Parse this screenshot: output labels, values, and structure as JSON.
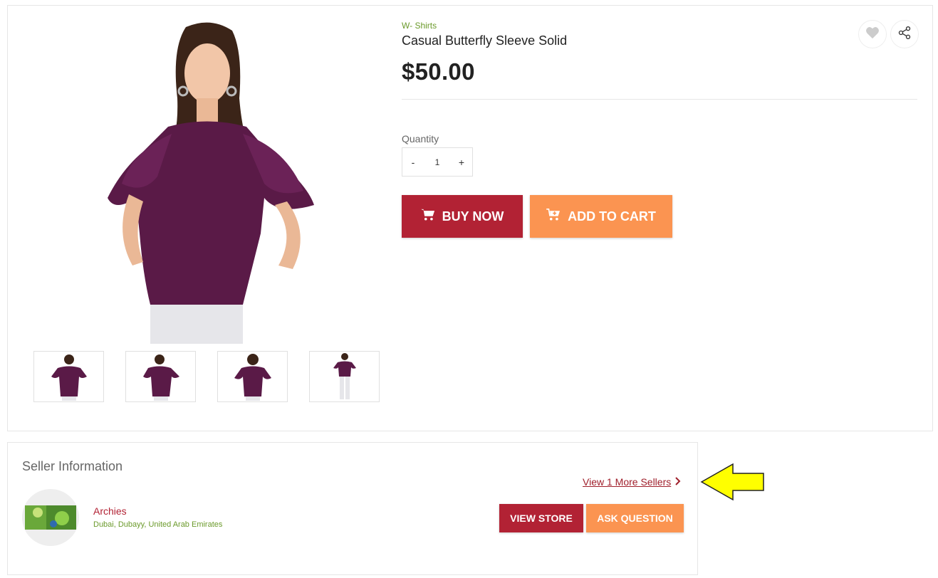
{
  "product": {
    "category": "W- Shirts",
    "title": "Casual Butterfly Sleeve Solid",
    "price": "$50.00",
    "quantity_label": "Quantity",
    "quantity_value": "1",
    "decrement": "-",
    "increment": "+",
    "buy_now": "BUY NOW",
    "add_to_cart": "ADD TO CART",
    "image_color": "#5a1a47",
    "thumbnails": [
      {
        "name": "thumb-front"
      },
      {
        "name": "thumb-side"
      },
      {
        "name": "thumb-back"
      },
      {
        "name": "thumb-full"
      }
    ]
  },
  "seller": {
    "heading": "Seller Information",
    "more_sellers": "View 1 More Sellers",
    "name": "Archies",
    "location": "Dubai, Dubayy, United Arab Emirates",
    "view_store": "VIEW STORE",
    "ask_question": "ASK QUESTION"
  },
  "colors": {
    "primary": "#b22234",
    "secondary": "#fb9451",
    "category": "#6b9a2b",
    "annotation_arrow": "#ffff00"
  },
  "icons": {
    "wishlist": "heart-icon",
    "share": "share-icon",
    "cart": "cart-icon",
    "chevron": "chevron-right-icon"
  }
}
